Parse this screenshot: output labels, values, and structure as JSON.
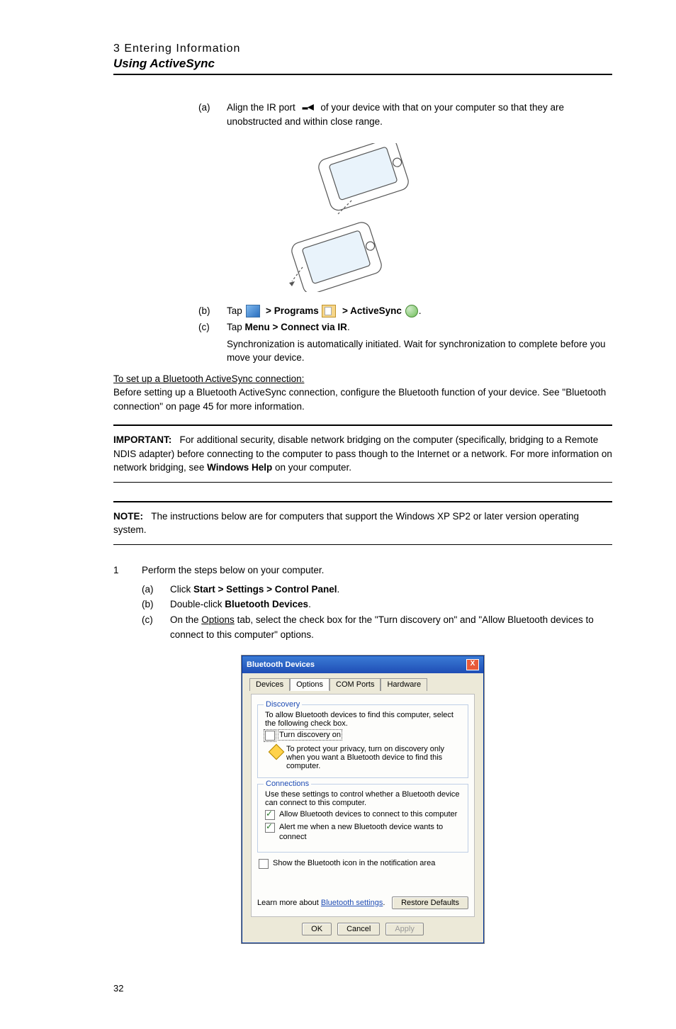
{
  "header": {
    "chapter": "3 Entering Information",
    "section": "Using ActiveSync"
  },
  "steps1": {
    "a": {
      "label": "(a)",
      "pre": "Align the IR port ",
      "post": " of your device with that on your computer so that they are unobstructed and within close range."
    },
    "b": {
      "label": "(b)",
      "pre": "Tap ",
      "programs": "Programs",
      "activesync": "ActiveSync"
    },
    "c": {
      "label": "(c)",
      "text_pre": "Tap ",
      "bold": "Menu > Connect via IR",
      "text_post": ".",
      "detail": "Synchronization is automatically initiated. Wait for synchronization to complete before you move your device."
    }
  },
  "bt_heading": "To set up a Bluetooth ActiveSync connection:",
  "bt_intro": "Before setting up a Bluetooth ActiveSync connection, configure the Bluetooth function of your device. See \"Bluetooth connection\" on page 45 for more information.",
  "important": {
    "label": "IMPORTANT:",
    "text_a": "For additional security, disable network bridging on the computer (specifically, bridging to a Remote NDIS adapter) before connecting to the computer to pass though to the Internet or a network. For more information on network bridging, see ",
    "bold": "Windows Help",
    "text_b": " on your computer."
  },
  "note": {
    "label": "NOTE:",
    "text": "The instructions below are for computers that support the Windows XP SP2 or later version operating system."
  },
  "step_num": {
    "num": "1",
    "text": "Perform the steps below on your computer."
  },
  "substeps": {
    "a": {
      "label": "(a)",
      "pre": "Click ",
      "bold": "Start > Settings > Control Panel",
      "post": "."
    },
    "b": {
      "label": "(b)",
      "pre": "Double-click ",
      "bold": "Bluetooth Devices",
      "post": "."
    },
    "c": {
      "label": "(c)",
      "pre": "On the ",
      "u": "Options",
      "post": " tab, select the check box for the \"Turn discovery on\" and \"Allow Bluetooth devices to connect to this computer\" options."
    }
  },
  "dialog": {
    "title": "Bluetooth Devices",
    "close": "X",
    "tabs": {
      "devices": "Devices",
      "options": "Options",
      "com": "COM Ports",
      "hardware": "Hardware"
    },
    "discovery": {
      "title": "Discovery",
      "text": "To allow Bluetooth devices to find this computer, select the following check box.",
      "cb": "Turn discovery on",
      "warn": "To protect your privacy, turn on discovery only when you want a Bluetooth device to find this computer."
    },
    "connections": {
      "title": "Connections",
      "text": "Use these settings to control whether a Bluetooth device can connect to this computer.",
      "cb1": "Allow Bluetooth devices to connect to this computer",
      "cb2": "Alert me when a new Bluetooth device wants to connect"
    },
    "notify_cb": "Show the Bluetooth icon in the notification area",
    "learn_pre": "Learn more about ",
    "learn_link": "Bluetooth settings",
    "learn_post": ".",
    "restore": "Restore Defaults",
    "ok": "OK",
    "cancel": "Cancel",
    "apply": "Apply"
  },
  "pagenum": "32"
}
